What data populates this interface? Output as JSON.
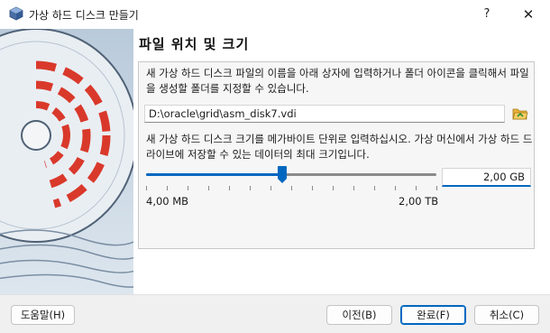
{
  "window": {
    "title": "가상 하드 디스크 만들기",
    "help_glyph": "?",
    "close_glyph": "✕",
    "app_icon": "virtualbox-icon"
  },
  "page": {
    "heading": "파일 위치 및 크기",
    "location_description": "새 가상 하드 디스크 파일의 이름을 아래 상자에 입력하거나 폴더 아이콘을 클릭해서 파일을 생성할 폴더를 지정할 수 있습니다.",
    "file_path": "D:\\oracle\\grid\\asm_disk7.vdi",
    "size_description": "새 가상 하드 디스크 크기를 메가바이트 단위로 입력하십시오. 가상 머신에서 가상 하드 드라이브에 저장할 수 있는 데이터의 최대 크기입니다.",
    "size_value": "2,00 GB",
    "slider_min_label": "4,00 MB",
    "slider_max_label": "2,00 TB",
    "slider_position_fraction": 0.47,
    "slider_tick_count": 14,
    "folder_icon": "folder-open-icon"
  },
  "buttons": {
    "help": "도움말(H)",
    "back": "이전(B)",
    "finish": "완료(F)",
    "cancel": "취소(C)"
  },
  "colors": {
    "accent": "#0067c0",
    "side_panel": "#c9d6e3",
    "disk_red": "#d9392b"
  }
}
